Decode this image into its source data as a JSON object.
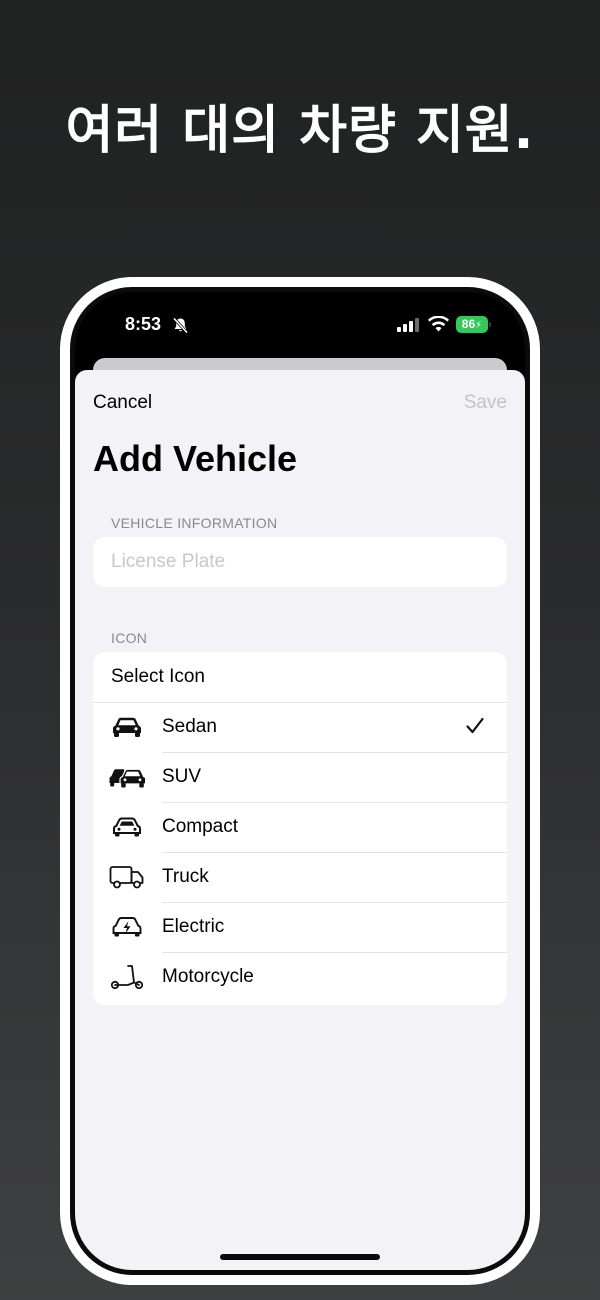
{
  "headline": "여러 대의 차량 지원.",
  "status_bar": {
    "time": "8:53",
    "battery": "86",
    "icons": [
      "bell-slash-icon",
      "signal-icon",
      "wifi-icon",
      "battery-icon"
    ]
  },
  "nav": {
    "cancel_label": "Cancel",
    "save_label": "Save"
  },
  "title": "Add Vehicle",
  "vehicle_section": {
    "header": "VEHICLE INFORMATION",
    "license_plate_placeholder": "License Plate",
    "license_plate_value": ""
  },
  "icon_section": {
    "header": "ICON",
    "select_label": "Select Icon",
    "selected": "Sedan",
    "options": [
      {
        "label": "Sedan",
        "icon": "sedan-icon"
      },
      {
        "label": "SUV",
        "icon": "suv-icon"
      },
      {
        "label": "Compact",
        "icon": "compact-car-icon"
      },
      {
        "label": "Truck",
        "icon": "truck-icon"
      },
      {
        "label": "Electric",
        "icon": "electric-car-icon"
      },
      {
        "label": "Motorcycle",
        "icon": "scooter-icon"
      }
    ]
  },
  "colors": {
    "background_top": "#202121",
    "background_bottom": "#3f4041",
    "sheet": "#f2f2f7",
    "card": "#ffffff",
    "placeholder": "#c7c7cc",
    "section_header": "#8a8a8e",
    "battery_green": "#34c759",
    "save_disabled": "#c4c4c8"
  }
}
